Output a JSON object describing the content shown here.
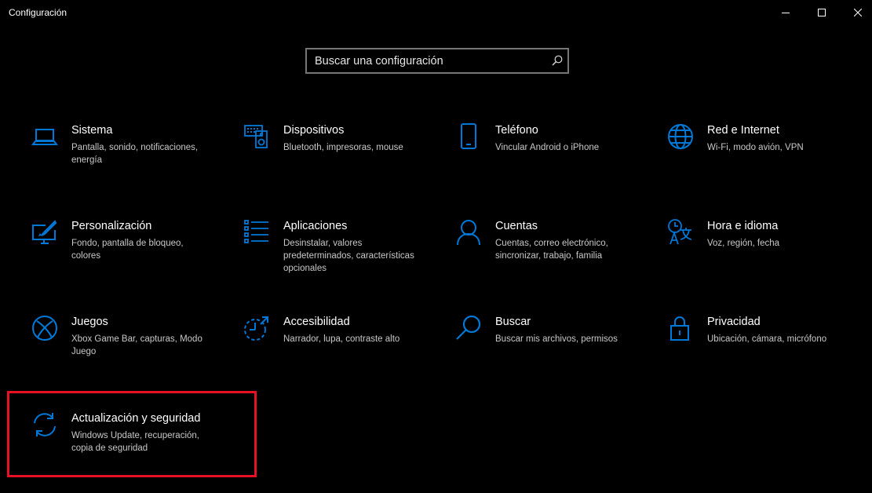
{
  "window": {
    "title": "Configuración"
  },
  "search": {
    "placeholder": "Buscar una configuración",
    "icon": "search-icon"
  },
  "accent_color": "#0078d7",
  "highlight_color": "#e81123",
  "tiles": [
    {
      "name": "Sistema",
      "desc": "Pantalla, sonido, notificaciones, energía",
      "icon": "laptop-icon"
    },
    {
      "name": "Dispositivos",
      "desc": "Bluetooth, impresoras, mouse",
      "icon": "keyboard-speaker-icon"
    },
    {
      "name": "Teléfono",
      "desc": "Vincular Android o iPhone",
      "icon": "phone-icon"
    },
    {
      "name": "Red e Internet",
      "desc": "Wi-Fi, modo avión, VPN",
      "icon": "globe-icon"
    },
    {
      "name": "Personalización",
      "desc": "Fondo, pantalla de bloqueo, colores",
      "icon": "paint-brush-icon"
    },
    {
      "name": "Aplicaciones",
      "desc": "Desinstalar, valores predeterminados, características opcionales",
      "icon": "apps-list-icon"
    },
    {
      "name": "Cuentas",
      "desc": "Cuentas, correo electrónico, sincronizar, trabajo, familia",
      "icon": "person-icon"
    },
    {
      "name": "Hora e idioma",
      "desc": "Voz, región, fecha",
      "icon": "time-language-icon"
    },
    {
      "name": "Juegos",
      "desc": "Xbox Game Bar, capturas, Modo Juego",
      "icon": "xbox-icon"
    },
    {
      "name": "Accesibilidad",
      "desc": "Narrador, lupa, contraste alto",
      "icon": "accessibility-timer-icon"
    },
    {
      "name": "Buscar",
      "desc": "Buscar mis archivos, permisos",
      "icon": "magnifier-icon"
    },
    {
      "name": "Privacidad",
      "desc": "Ubicación, cámara, micrófono",
      "icon": "lock-icon"
    },
    {
      "name": "Actualización y seguridad",
      "desc": "Windows Update, recuperación, copia de seguridad",
      "icon": "sync-arrows-icon"
    }
  ]
}
